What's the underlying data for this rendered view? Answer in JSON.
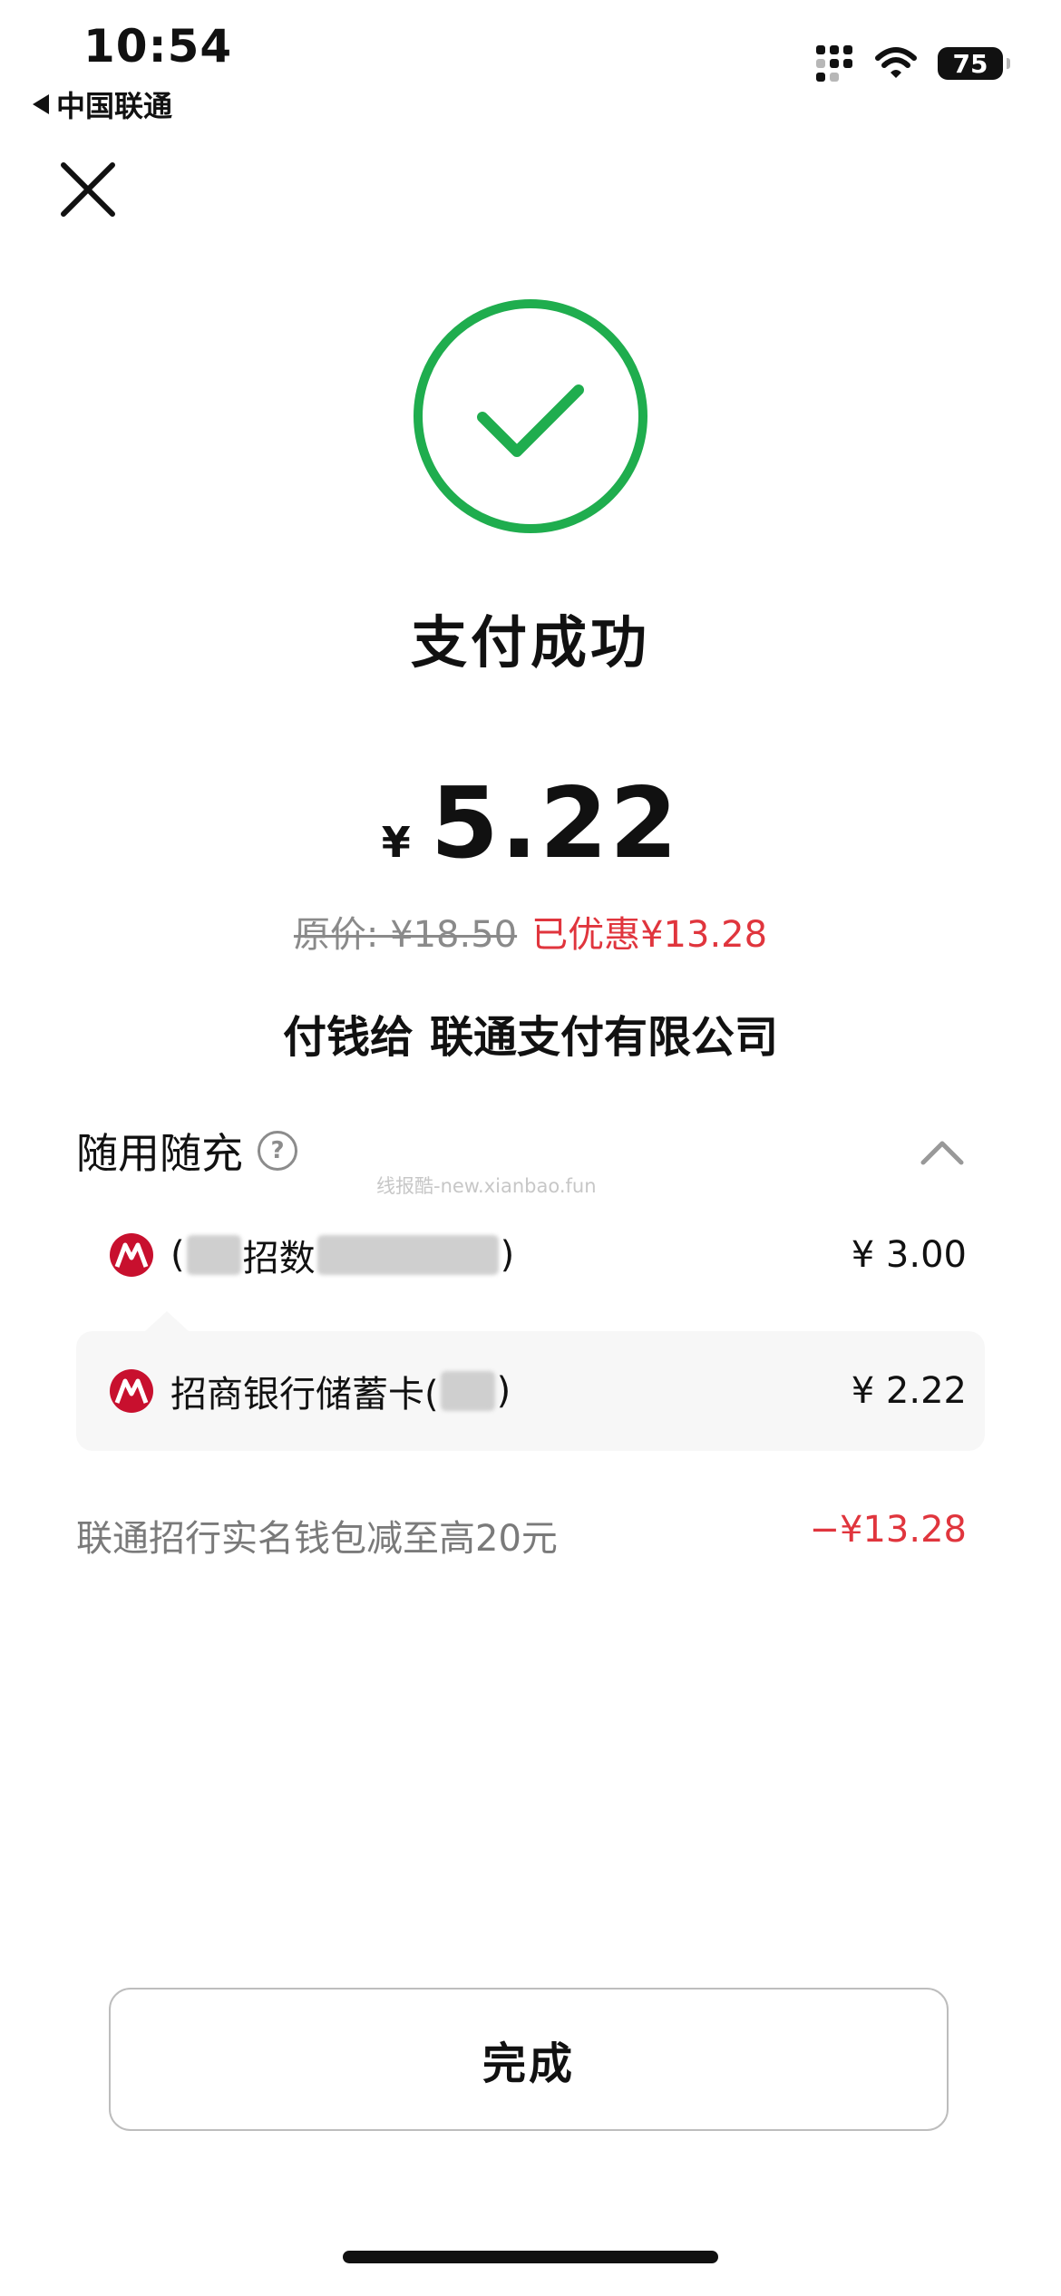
{
  "status_bar": {
    "time": "10:54",
    "carrier": "中国联通",
    "battery_level": "75"
  },
  "result": {
    "title": "支付成功",
    "currency": "¥",
    "amount": "5.22",
    "original_price_label": "原价: ¥18.50",
    "discount_label": "已优惠¥13.28",
    "payee_prefix": "付钱给",
    "payee_name": "联通支付有限公司"
  },
  "details": {
    "section_title": "随用随充",
    "help_symbol": "?",
    "payments": [
      {
        "visible_prefix": "(",
        "visible_middle": "招数",
        "visible_suffix": ")",
        "amount": "¥ 3.00"
      },
      {
        "visible_prefix": "招商银行储蓄卡(",
        "visible_suffix": ")",
        "amount": "¥ 2.22"
      }
    ],
    "promotion": {
      "label": "联通招行实名钱包减至高20元",
      "amount": "−¥13.28"
    }
  },
  "watermark": "线报酷-new.xianbao.fun",
  "actions": {
    "done_label": "完成"
  },
  "colors": {
    "success_green": "#1fad4e",
    "discount_red": "#e0353d",
    "bank_red": "#c8102e"
  }
}
